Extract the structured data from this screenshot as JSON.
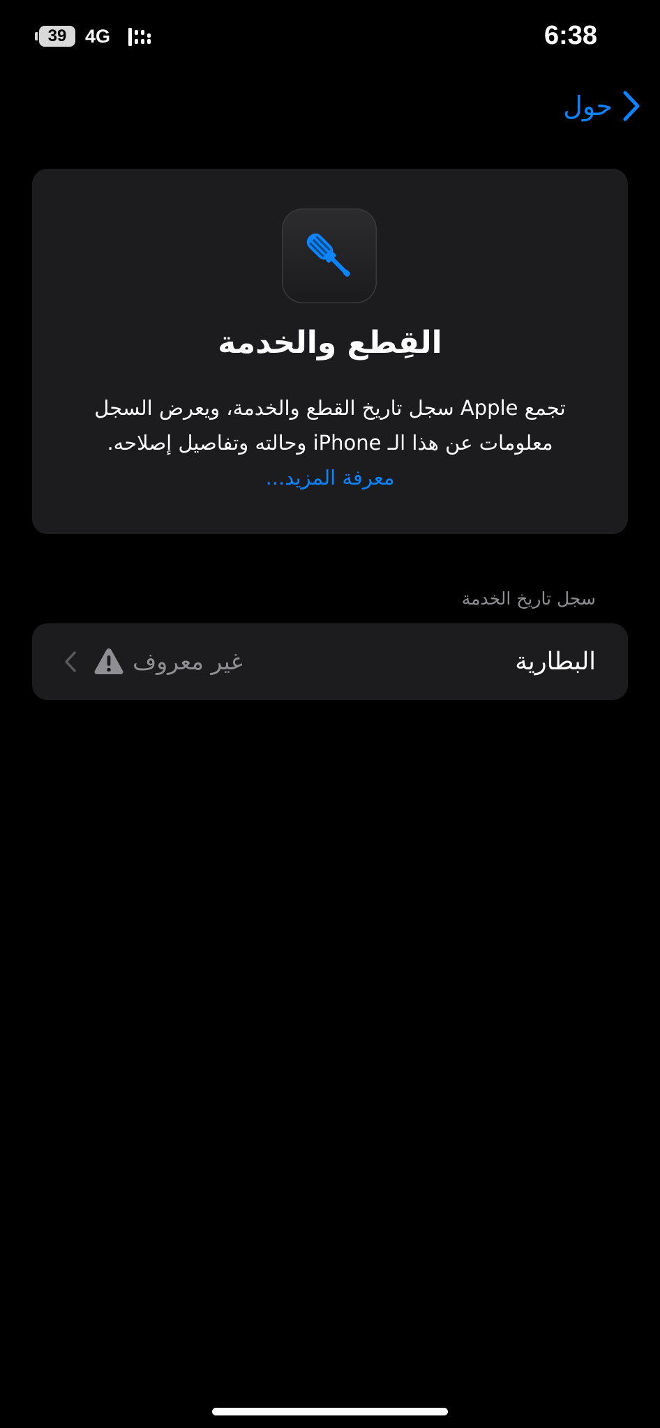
{
  "status_bar": {
    "battery_level": "39",
    "network": "4G",
    "time": "6:38"
  },
  "nav": {
    "back_label": "حول"
  },
  "info_card": {
    "icon": "screwdriver-icon",
    "title": "القِطع والخدمة",
    "description_line1": "تجمع Apple سجل تاريخ القطع والخدمة، ويعرض السجل",
    "description_line2": "معلومات عن هذا الـ iPhone وحالته وتفاصيل إصلاحه.",
    "learn_more": "معرفة المزيد..."
  },
  "service_history": {
    "header": "سجل تاريخ الخدمة",
    "items": [
      {
        "label": "البطارية",
        "value": "غير معروف",
        "status_icon": "warning-icon"
      }
    ]
  },
  "colors": {
    "accent": "#0a84ff",
    "background": "#000000",
    "card": "#1c1c1e",
    "secondary_text": "#8e8e93"
  }
}
